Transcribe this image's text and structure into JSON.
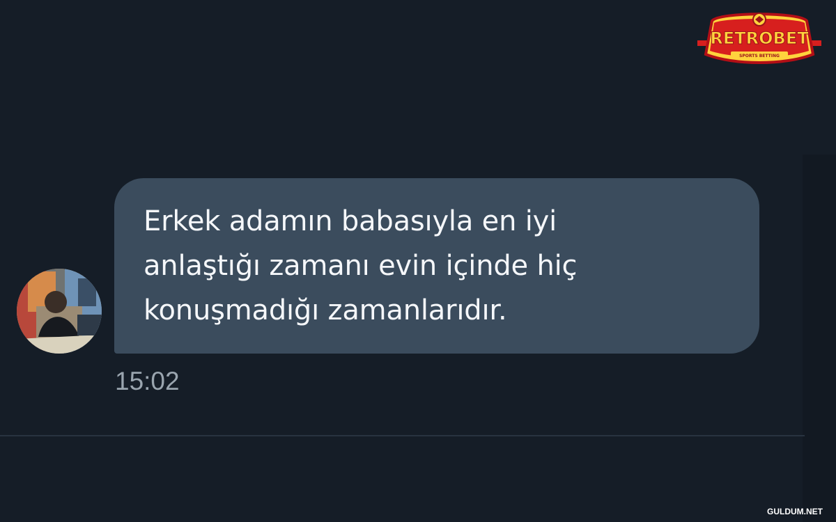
{
  "colors": {
    "background": "#151d27",
    "bubble": "#3b4c5d",
    "message_text": "#f5f7fa",
    "timestamp": "#9aa5af",
    "divider": "#283340",
    "logo_red": "#d71f1e",
    "logo_yellow": "#ffd33d"
  },
  "icons": {
    "avatar": "profile-photo",
    "watermark_logo": "retrobet-logo"
  },
  "watermark": {
    "brand_text": "RETROBET",
    "sub_text": "SPORTS BETTING",
    "site_text": "GULDUM.NET"
  },
  "message": {
    "lines": [
      "Erkek adamın babasıyla en iyi",
      "anlaştığı zamanı evin içinde hiç",
      "konuşmadığı zamanlarıdır."
    ],
    "time": "15:02"
  }
}
